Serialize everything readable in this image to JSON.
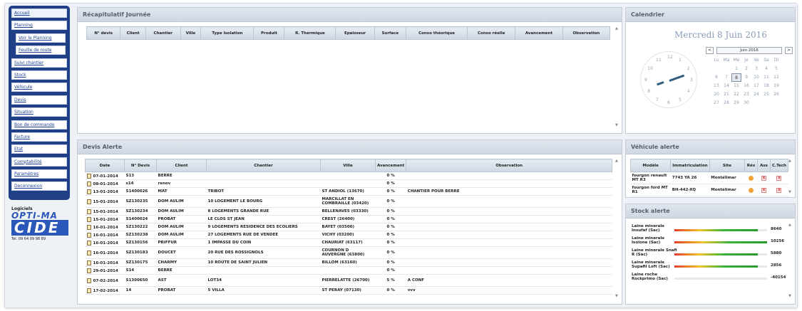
{
  "sidebar": {
    "items": [
      {
        "label": "Accueil",
        "sub": false,
        "active": true
      },
      {
        "label": "Planning",
        "sub": false
      },
      {
        "label": "Voir le Planning",
        "sub": true
      },
      {
        "label": "Feuille de route",
        "sub": true
      },
      {
        "label": "Suivi chantier",
        "sub": false
      },
      {
        "label": "Stock",
        "sub": false
      },
      {
        "label": "Véhicule",
        "sub": false
      },
      {
        "label": "Devis",
        "sub": false
      },
      {
        "label": "Situation",
        "sub": false
      },
      {
        "label": "Bon de commande",
        "sub": false
      },
      {
        "label": "Facture",
        "sub": false
      },
      {
        "label": "Etat",
        "sub": false
      },
      {
        "label": "Comptabilité",
        "sub": false
      },
      {
        "label": "Paramètres",
        "sub": false
      },
      {
        "label": "Deconnexion",
        "sub": false
      }
    ]
  },
  "logo": {
    "line1": "Logiciels",
    "line2": "OPTI-MA",
    "line3": "CIDE",
    "phone": "Tel. 09 64 09 98 89"
  },
  "recap": {
    "title": "Récapitulatif Journée",
    "headers": [
      "N° devis",
      "Client",
      "Chantier",
      "Ville",
      "Type Isolation",
      "Produit",
      "R. Thermique",
      "Epaisseur",
      "Surface",
      "Conso théorique",
      "Conso réelle",
      "Avancement",
      "Observation"
    ]
  },
  "calendar": {
    "panel_title": "Calendrier",
    "date_title": "Mercredi 8 Juin 2016",
    "month_label": "Juin 2016",
    "prev": "<",
    "next": ">",
    "weekdays": [
      "Lu",
      "Ma",
      "Me",
      "Je",
      "Ve",
      "Sa",
      "Di"
    ],
    "days": [
      "",
      "",
      "1",
      "2",
      "3",
      "4",
      "5",
      "6",
      "7",
      "8",
      "9",
      "10",
      "11",
      "12",
      "13",
      "14",
      "15",
      "16",
      "17",
      "18",
      "19",
      "20",
      "21",
      "22",
      "23",
      "24",
      "25",
      "26",
      "27",
      "28",
      "29",
      "30",
      "",
      "",
      ""
    ],
    "today": "8",
    "clock_numbers": [
      "12",
      "1",
      "2",
      "3",
      "4",
      "5",
      "6",
      "7",
      "8",
      "9",
      "10",
      "11"
    ]
  },
  "devis": {
    "title": "Devis Alerte",
    "headers": [
      "Date",
      "N° Devis",
      "Client",
      "Chantier",
      "Ville",
      "Avancement",
      "Observation"
    ],
    "rows": [
      {
        "date": "07-01-2014",
        "num": "S13",
        "client": "BERRE",
        "chantier": "",
        "ville": "",
        "avancement": "0 %",
        "obs": ""
      },
      {
        "date": "08-01-2014",
        "num": "s14",
        "client": "renov",
        "chantier": "",
        "ville": "",
        "avancement": "0 %",
        "obs": ""
      },
      {
        "date": "13-01-2014",
        "num": "S1400026",
        "client": "MAT",
        "chantier": "TRIBOT",
        "ville": "ST ANDIOL (13670)",
        "avancement": "0 %",
        "obs": "CHANTIER POUR BERRE"
      },
      {
        "date": "15-01-2014",
        "num": "SZ130235",
        "client": "DOM AULIM",
        "chantier": "10 LOGEMENT LE BOURG",
        "ville": "MARCILLAT EN COMBRAILLE (03420)",
        "avancement": "0 %",
        "obs": "",
        "tall": true
      },
      {
        "date": "15-01-2014",
        "num": "SZ130234",
        "client": "DOM AULIM",
        "chantier": "8 LOGEMENTS GRANDE RUE",
        "ville": "BELLENAVES (03330)",
        "avancement": "0 %",
        "obs": ""
      },
      {
        "date": "15-01-2014",
        "num": "S1400024",
        "client": "PROBAT",
        "chantier": "LE CLOS ST JEAN",
        "ville": "CREST (26400)",
        "avancement": "0 %",
        "obs": ""
      },
      {
        "date": "16-01-2014",
        "num": "SZ130222",
        "client": "DOM AULIM",
        "chantier": "9 LOGEMENTS RESIDENCE DES ECOLIERS",
        "ville": "BAYET (03500)",
        "avancement": "0 %",
        "obs": ""
      },
      {
        "date": "16-01-2014",
        "num": "SZ130238",
        "client": "DOM AULIM",
        "chantier": "27 LOGEMENTS RUE DE VENDEE",
        "ville": "VICHY (03200)",
        "avancement": "0 %",
        "obs": ""
      },
      {
        "date": "16-01-2014",
        "num": "SZ130156",
        "client": "PRIFFUR",
        "chantier": "1 IMPASSE DU COIN",
        "ville": "CHAURIAT (63117)",
        "avancement": "0 %",
        "obs": ""
      },
      {
        "date": "16-01-2014",
        "num": "SZ130183",
        "client": "DOUCET",
        "chantier": "20 RUE DES ROSSIGNOLS",
        "ville": "COURNON D AUVERGNE (63800)",
        "avancement": "0 %",
        "obs": "",
        "tall": true
      },
      {
        "date": "16-01-2014",
        "num": "SZ130175",
        "client": "CHARMY",
        "chantier": "10 ROUTE DE SAINT JULIEN",
        "ville": "BILLOM (63160)",
        "avancement": "0 %",
        "obs": ""
      },
      {
        "date": "29-01-2014",
        "num": "S14",
        "client": "BERRE",
        "chantier": "",
        "ville": "",
        "avancement": "0 %",
        "obs": ""
      },
      {
        "date": "07-02-2014",
        "num": "S1300650",
        "client": "AST",
        "chantier": "LOT34",
        "ville": "PIERRELATTE (26700)",
        "avancement": "5 %",
        "obs": "A CONF",
        "tall": true
      },
      {
        "date": "17-02-2014",
        "num": "14",
        "client": "PROBAT",
        "chantier": "5 VILLA",
        "ville": "ST PERAY (07130)",
        "avancement": "0 %",
        "obs": "vvv"
      }
    ]
  },
  "vehicules": {
    "title": "Véhicule alerte",
    "headers": [
      "Modèle",
      "Immatriculation",
      "Site",
      "Rév",
      "Ass",
      "C.Tech"
    ],
    "rows": [
      {
        "modele": "fourgon renault MT R3",
        "immat": "7743 YA 26",
        "site": "Montélimar"
      },
      {
        "modele": "fourgon ford MT R1",
        "immat": "BH-442-XQ",
        "site": "Montélimar"
      }
    ],
    "x_label": "x"
  },
  "stock": {
    "title": "Stock alerte",
    "rows": [
      {
        "label": "Laine minerale Insufaf (Sac)",
        "value": "8640",
        "level": 0.9
      },
      {
        "label": "Laine minerale Isolone (Sac)",
        "value": "10256",
        "level": 1.0
      },
      {
        "label": "Laine minerale Snafi R (Sac)",
        "value": "5880",
        "level": 0.9
      },
      {
        "label": "Laine minerale Supafil Loft (Sac)",
        "value": "2856",
        "level": 0.9
      },
      {
        "label": "Laine roche Rockprimo (Sac)",
        "value": "-40154",
        "level": 0
      }
    ]
  }
}
